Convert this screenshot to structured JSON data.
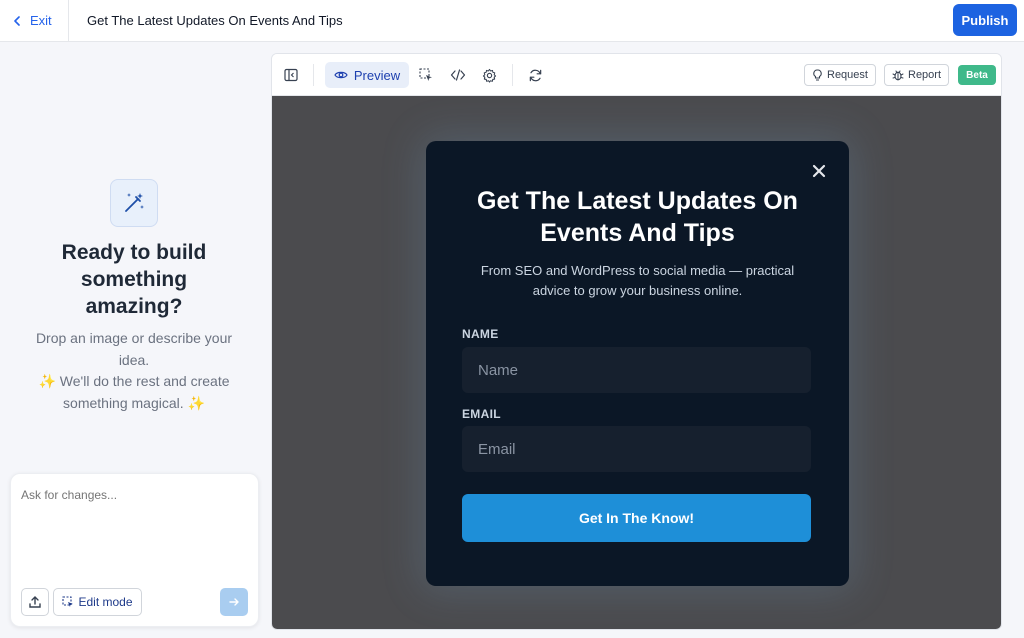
{
  "topbar": {
    "exit_label": "Exit",
    "title": "Get The Latest Updates On Events And Tips",
    "publish_label": "Publish"
  },
  "left_panel": {
    "heading": "Ready to build something amazing?",
    "description": "Drop an image or describe your idea.\n✨ We'll do the rest and create something magical. ✨",
    "chat_placeholder": "Ask for changes...",
    "edit_mode_label": "Edit mode"
  },
  "toolbar": {
    "preview_label": "Preview",
    "request_label": "Request",
    "report_label": "Report",
    "beta_label": "Beta"
  },
  "modal": {
    "title": "Get The Latest Updates On Events And Tips",
    "subtitle": "From SEO and WordPress to social media — practical advice to grow your business online.",
    "name_label": "NAME",
    "name_placeholder": "Name",
    "email_label": "EMAIL",
    "email_placeholder": "Email",
    "cta_label": "Get In The Know!"
  },
  "colors": {
    "accent": "#1d63e1",
    "cta": "#1e8fd8",
    "modal_bg": "#0b1726",
    "beta": "#3fb98a"
  }
}
